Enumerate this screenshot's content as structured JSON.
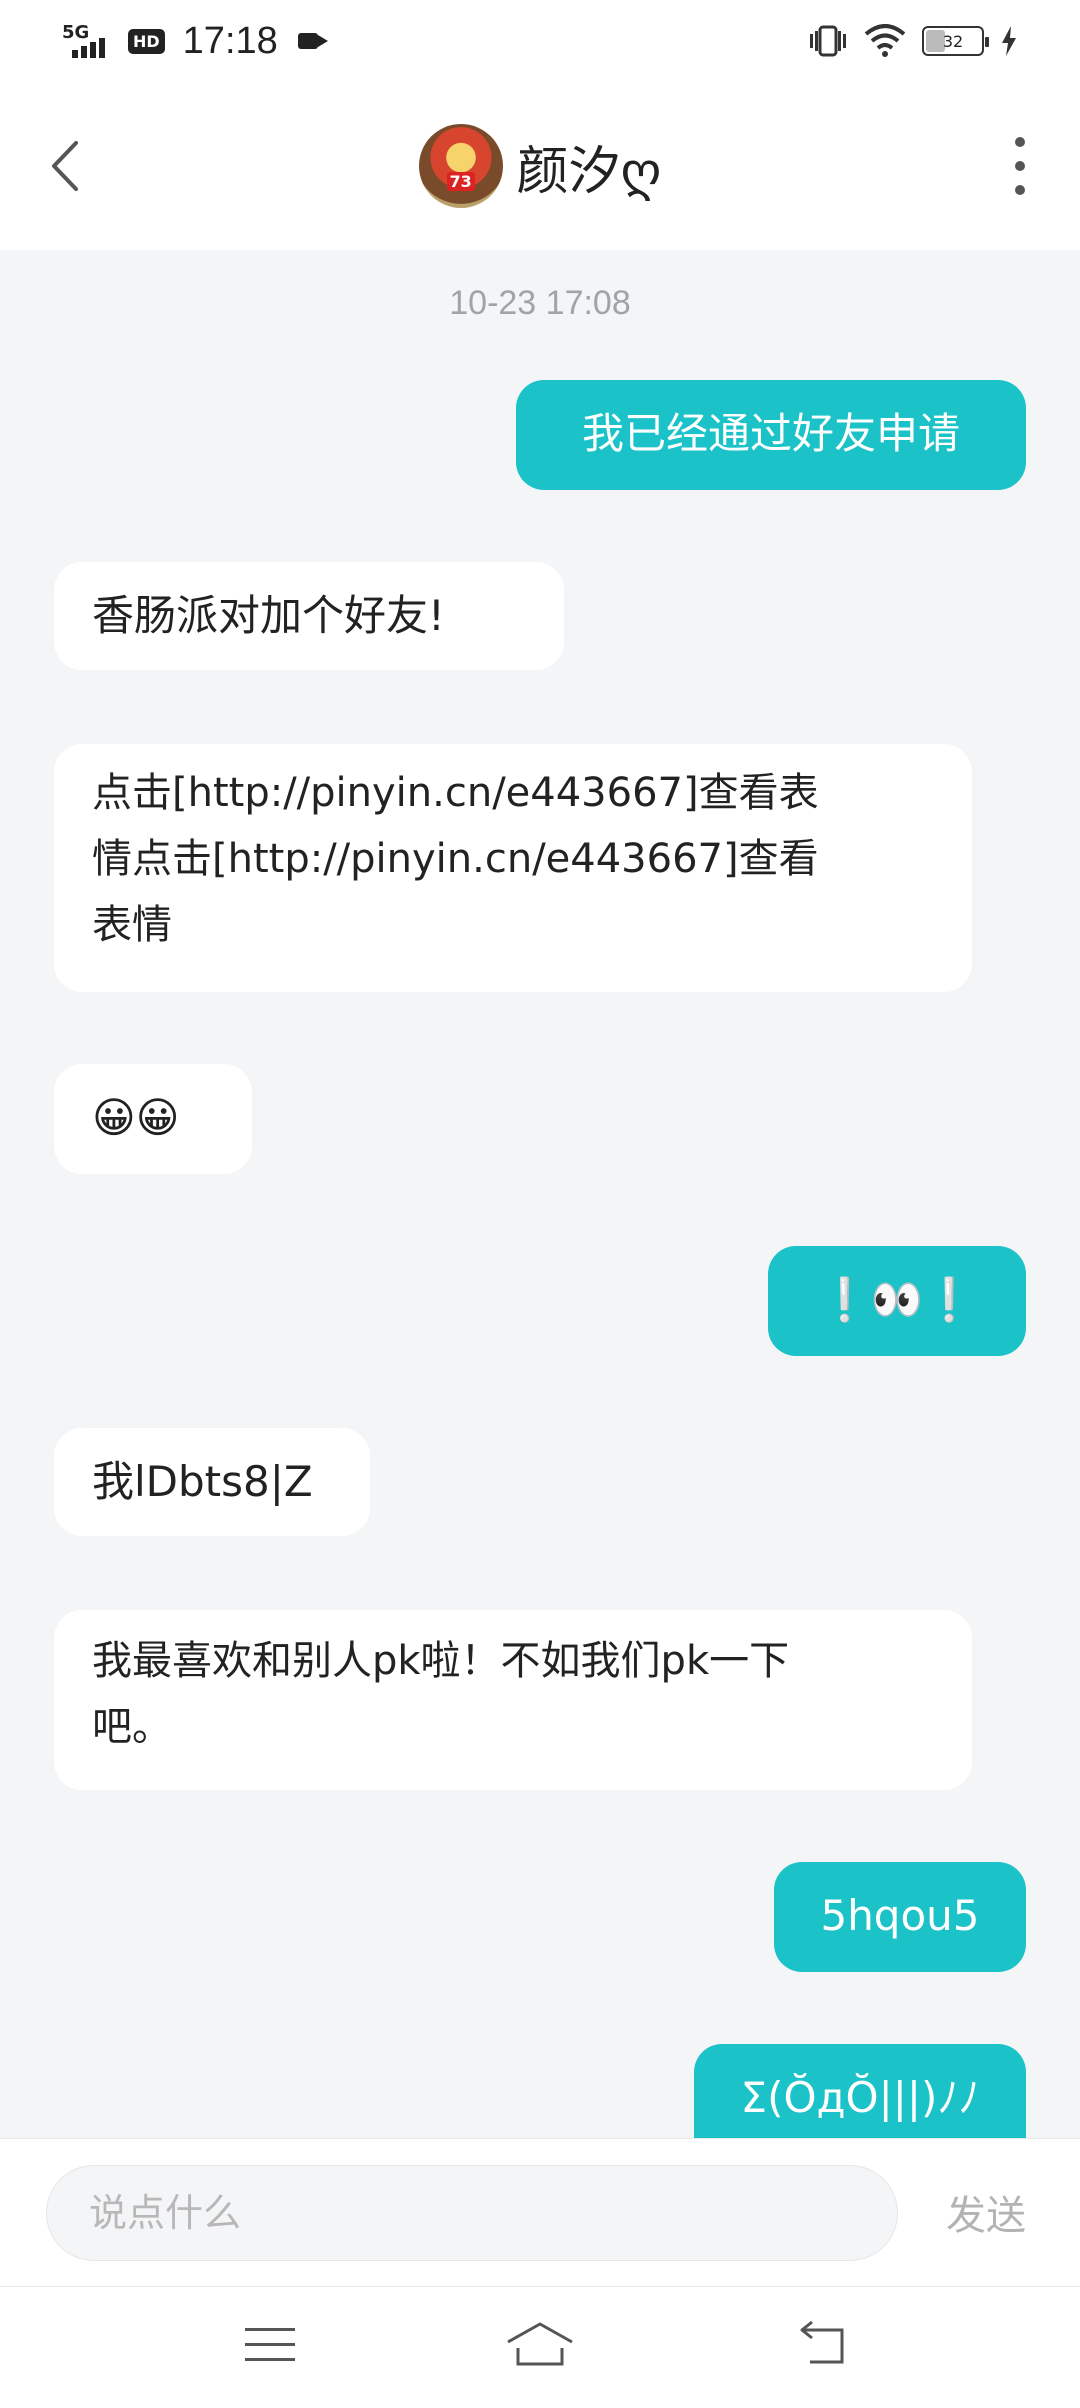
{
  "status_bar": {
    "network": "5G",
    "hd": "HD",
    "time": "17:18",
    "battery_level": "32",
    "icons": [
      "video-record-icon",
      "vibrate-icon",
      "wifi-icon",
      "battery-icon",
      "charging-icon"
    ]
  },
  "header": {
    "contact_name": "颜汐ღ",
    "avatar_badge": "73",
    "icons": [
      "back-icon",
      "more-icon"
    ]
  },
  "chat": {
    "timestamp": "10-23 17:08",
    "messages": [
      {
        "direction": "out",
        "text": "我已经通过好友申请"
      },
      {
        "direction": "in",
        "text": "香肠派对加个好友!"
      },
      {
        "direction": "in",
        "line1": "点击[http://pinyin.cn/e443667]查看表",
        "line2": "情点击[http://pinyin.cn/e443667]查看",
        "line3": "表情"
      },
      {
        "direction": "in",
        "text": "😀😀"
      },
      {
        "direction": "out",
        "text": "❕👀❕"
      },
      {
        "direction": "in",
        "text": "我lDbts8|Z"
      },
      {
        "direction": "in",
        "line1": "我最喜欢和别人pk啦！不如我们pk一下",
        "line2": "吧。"
      },
      {
        "direction": "out",
        "text": "5hqou5"
      },
      {
        "direction": "out",
        "text": "Σ(ŎдŎ|||)ﾉﾉ"
      }
    ]
  },
  "input": {
    "placeholder": "说点什么",
    "value": "",
    "send_label": "发送"
  },
  "nav": {
    "icons": [
      "menu-icon",
      "home-icon",
      "back-nav-icon"
    ]
  },
  "colors": {
    "accent": "#1bc3c9",
    "chat_background": "#f4f5f7",
    "incoming_bubble": "#ffffff",
    "timestamp_text": "#a0a4aa"
  }
}
